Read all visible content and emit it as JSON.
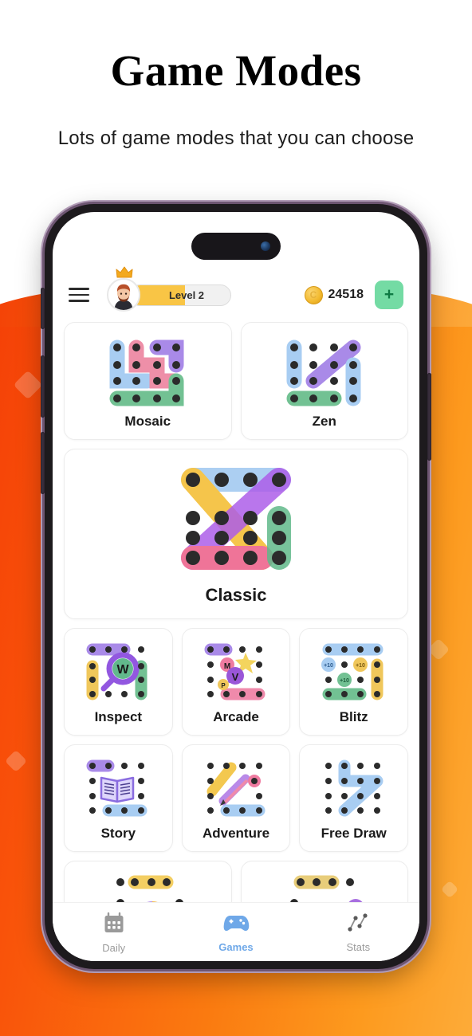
{
  "page": {
    "headline": "Game Modes",
    "subhead": "Lots of game modes that you can  choose"
  },
  "theme": {
    "bg_gradient_start": "#f33c06",
    "bg_gradient_end": "#fdb040",
    "accent_green": "#74dba4",
    "accent_blue": "#6fa8e8",
    "level_fill": "#f9c545"
  },
  "app_header": {
    "menu_icon": "hamburger-icon",
    "crown_icon": "crown-icon",
    "avatar_icon": "avatar",
    "level_label": "Level 2",
    "level_progress_percent": 55,
    "coin_icon": "coin-icon",
    "coin_symbol": "C",
    "coin_count": "24518",
    "add_label": "+"
  },
  "games": {
    "row_top": [
      {
        "title": "Mosaic",
        "art": "mosaic-art"
      },
      {
        "title": "Zen",
        "art": "zen-art"
      }
    ],
    "featured": {
      "title": "Classic",
      "art": "classic-art"
    },
    "row_mid": [
      {
        "title": "Inspect",
        "art": "inspect-art",
        "badge_letter": "W"
      },
      {
        "title": "Arcade",
        "art": "arcade-art",
        "bubbles": [
          "M",
          "V",
          "P"
        ]
      },
      {
        "title": "Blitz",
        "art": "blitz-art",
        "badges": [
          "+10",
          "+10",
          "+10"
        ]
      }
    ],
    "row_low": [
      {
        "title": "Story",
        "art": "story-art"
      },
      {
        "title": "Adventure",
        "art": "adventure-art"
      },
      {
        "title": "Free Draw",
        "art": "free-draw-art"
      }
    ],
    "row_partial": [
      {
        "title": "",
        "art": "gauge-art"
      },
      {
        "title": "",
        "art": "controller-art"
      }
    ]
  },
  "bottom_nav": {
    "items": [
      {
        "label": "Daily",
        "icon": "calendar-icon",
        "active": false
      },
      {
        "label": "Games",
        "icon": "gamepad-icon",
        "active": true
      },
      {
        "label": "Stats",
        "icon": "chart-scatter-icon",
        "active": false
      }
    ]
  }
}
